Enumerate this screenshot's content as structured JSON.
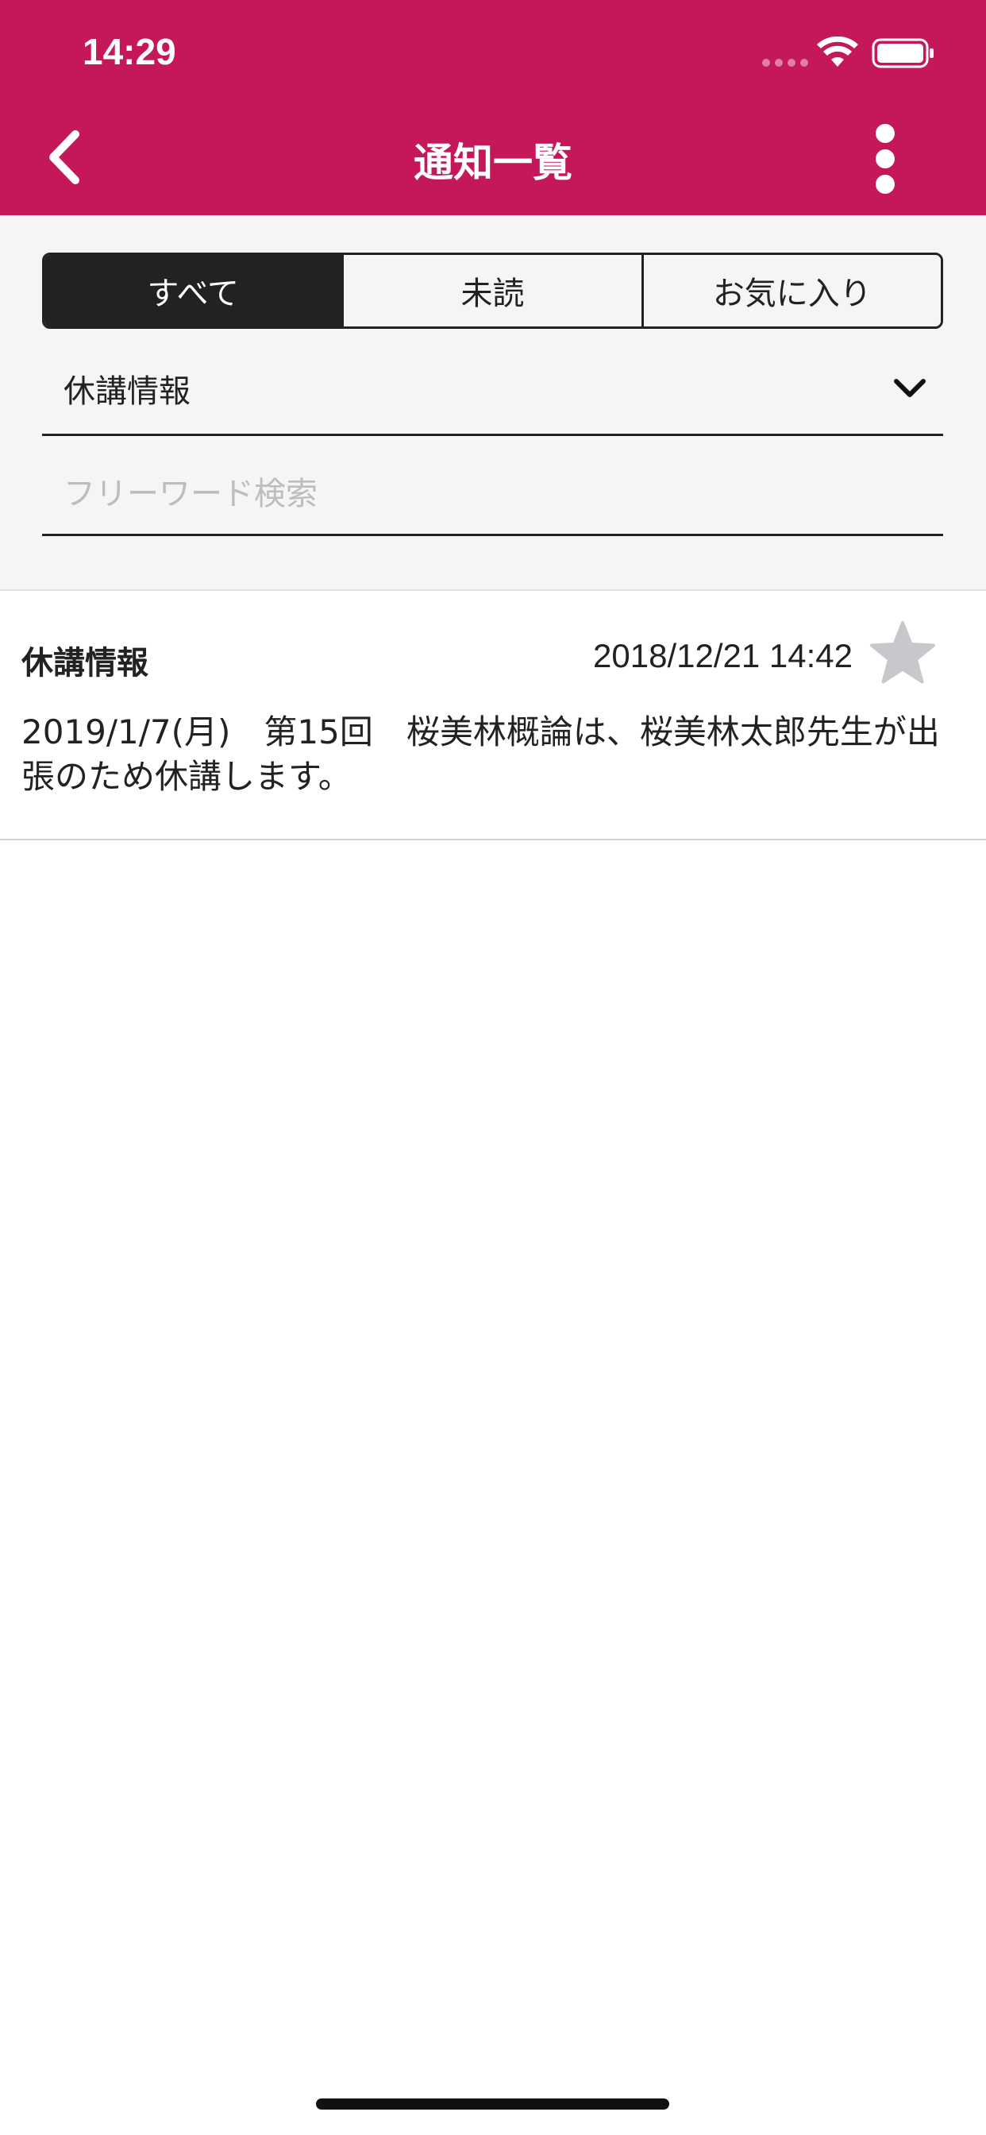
{
  "status_bar": {
    "time": "14:29"
  },
  "nav": {
    "title": "通知一覧",
    "back_icon": "chevron-left-icon",
    "menu_icon": "more-vertical-icon"
  },
  "filter": {
    "tabs": [
      {
        "label": "すべて",
        "selected": true
      },
      {
        "label": "未読",
        "selected": false
      },
      {
        "label": "お気に入り",
        "selected": false
      }
    ],
    "category_value": "休講情報",
    "search_value": "",
    "search_placeholder": "フリーワード検索"
  },
  "notices": [
    {
      "category": "休講情報",
      "datetime": "2018/12/21 14:42",
      "body": "2019/1/7(月)　第15回　桜美林概論は、桜美林太郎先生が出張のため休講します。",
      "favorite": false
    }
  ],
  "colors": {
    "brand": "#c4185b",
    "segment_active": "#222222",
    "star_inactive": "#c7c7cc"
  }
}
